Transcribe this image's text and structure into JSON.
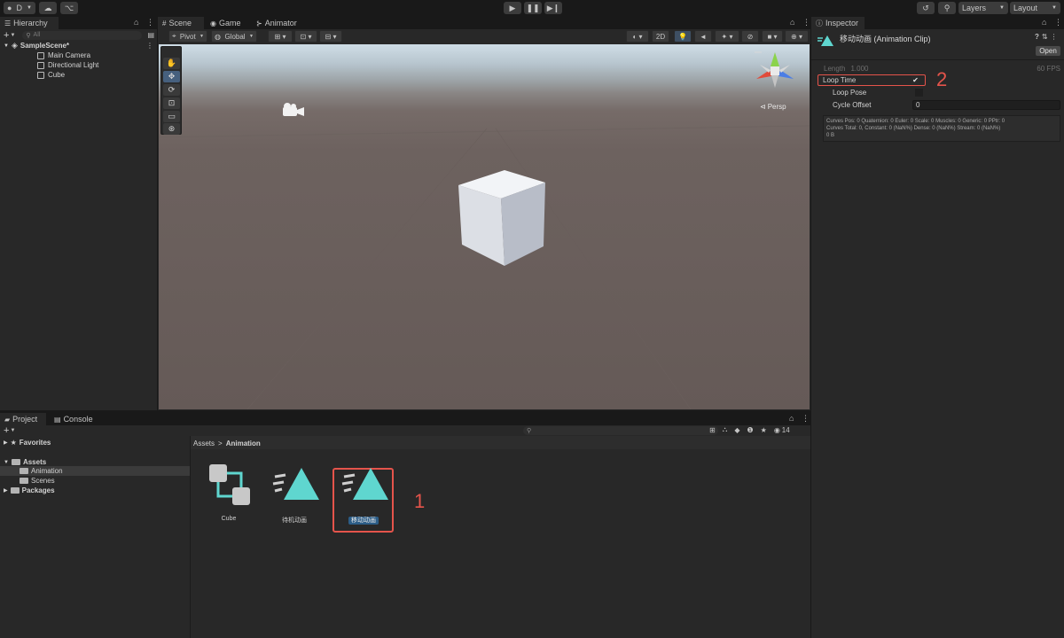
{
  "toolbar": {
    "account_label": "D",
    "layers_label": "Layers",
    "layout_label": "Layout"
  },
  "hierarchy": {
    "tab_label": "Hierarchy",
    "search_placeholder": "All",
    "scene_name": "SampleScene*",
    "items": [
      {
        "label": "Main Camera"
      },
      {
        "label": "Directional Light"
      },
      {
        "label": "Cube"
      }
    ]
  },
  "scene": {
    "tabs": [
      {
        "label": "Scene",
        "icon": "grid-icon"
      },
      {
        "label": "Game",
        "icon": "gamepad-icon"
      },
      {
        "label": "Animator",
        "icon": "animator-icon"
      }
    ],
    "pivot_label": "Pivot",
    "global_label": "Global",
    "mode_2d_label": "2D",
    "persp_label": "Persp"
  },
  "inspector": {
    "tab_label": "Inspector",
    "clip_title": "移动动画 (Animation Clip)",
    "open_label": "Open",
    "length_label": "Length",
    "length_value": "1.000",
    "fps_label": "60 FPS",
    "loop_time_label": "Loop Time",
    "loop_time_checked": true,
    "loop_pose_label": "Loop Pose",
    "cycle_offset_label": "Cycle Offset",
    "cycle_offset_value": "0",
    "info_line1": "Curves Pos: 0 Quaternion: 0 Euler: 0 Scale: 0 Muscles: 0 Generic: 0 PPtr: 0",
    "info_line2": "Curves Total: 0, Constant: 0 (NaN%) Dense: 0 (NaN%) Stream: 0 (NaN%)",
    "info_line3": "0 B"
  },
  "project": {
    "tabs": [
      {
        "label": "Project",
        "icon": "folder-icon"
      },
      {
        "label": "Console",
        "icon": "console-icon"
      }
    ],
    "visible_count": "14",
    "tree": {
      "favorites": "Favorites",
      "assets": "Assets",
      "animation": "Animation",
      "scenes": "Scenes",
      "packages": "Packages"
    },
    "breadcrumb": {
      "root": "Assets",
      "sep": ">",
      "current": "Animation"
    },
    "assets": [
      {
        "label": "Cube",
        "type": "animator-controller-icon"
      },
      {
        "label": "待机动画",
        "type": "animation-clip-icon"
      },
      {
        "label": "移动动画",
        "type": "animation-clip-icon",
        "selected": true
      }
    ]
  },
  "annotations": {
    "one": "1",
    "two": "2"
  },
  "colors": {
    "accent_blue": "#2c5d87",
    "annotation_red": "#e5544b",
    "clip_teal": "#5fd6cf"
  }
}
